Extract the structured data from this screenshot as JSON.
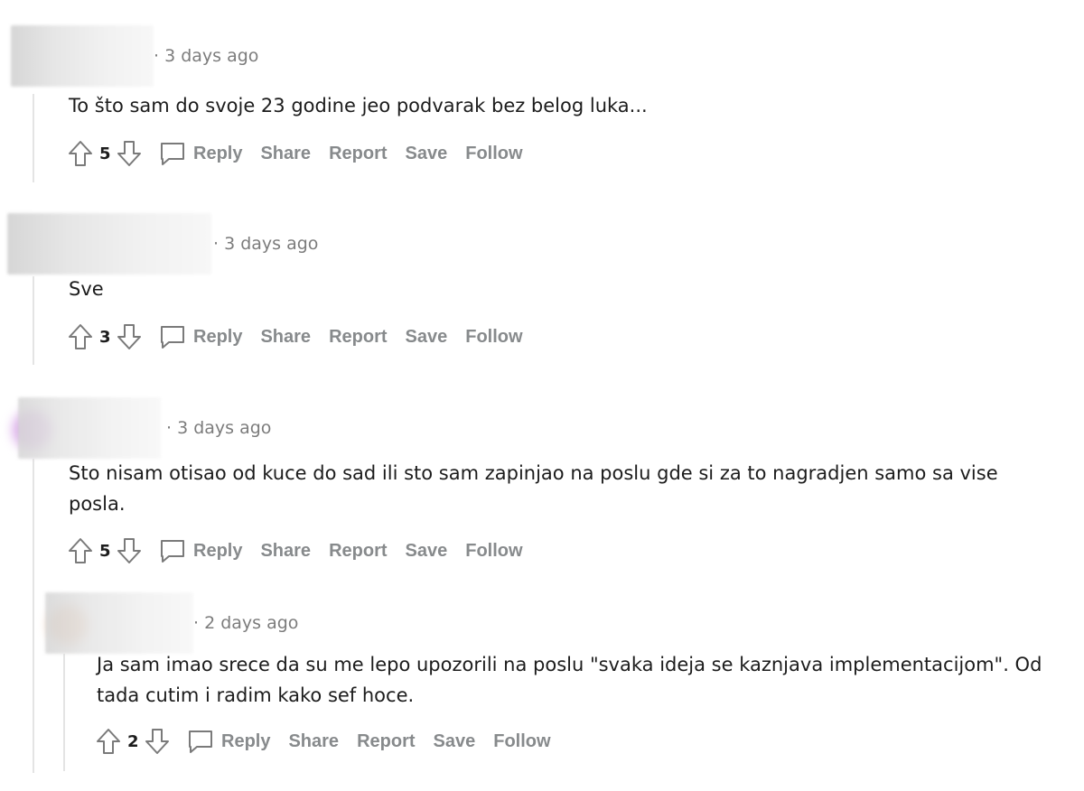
{
  "actions": {
    "reply": "Reply",
    "share": "Share",
    "report": "Report",
    "save": "Save",
    "follow": "Follow"
  },
  "comments": [
    {
      "time": "· 3 days ago",
      "text": "To što sam do svoje 23 godine jeo podvarak bez belog luka...",
      "score": "5"
    },
    {
      "time": "· 3 days ago",
      "text": "Sve",
      "score": "3"
    },
    {
      "time": "· 3 days ago",
      "text": "Sto nisam otisao od kuce do sad ili sto sam zapinjao na poslu gde si za to nagradjen samo sa vise posla.",
      "score": "5"
    },
    {
      "time": "· 2 days ago",
      "text": "Ja sam imao srece da su me lepo upozorili na poslu \"svaka ideja se kaznjava implementacijom\". Od tada cutim i radim kako sef hoce.",
      "score": "2"
    }
  ],
  "colors": {
    "avatar_3": "#d9a8e8",
    "avatar_4": "#f2c7a8"
  }
}
